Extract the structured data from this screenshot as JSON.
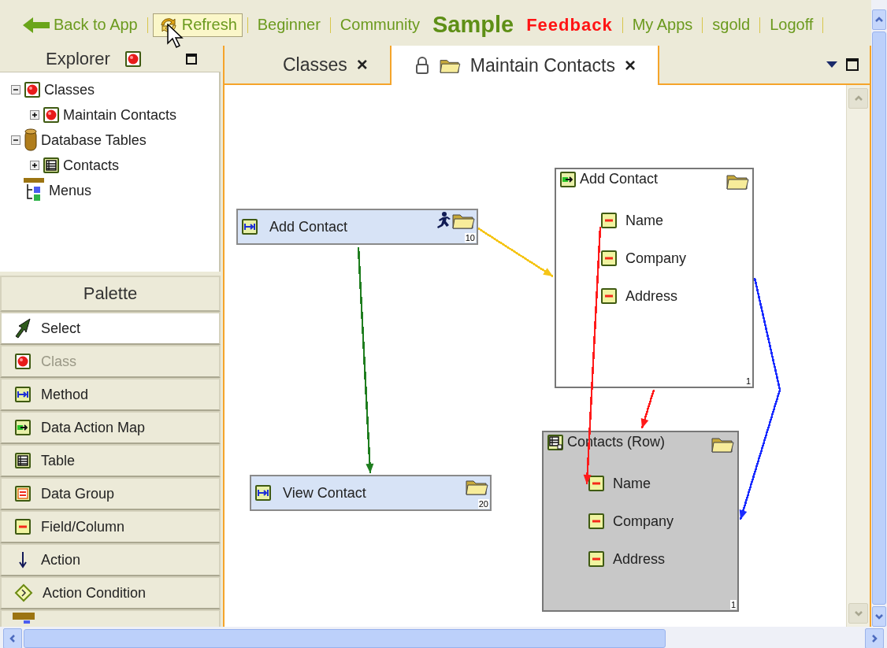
{
  "nav": [
    {
      "label": "Back to App",
      "kind": "back",
      "highlighted": false,
      "divider_after": true
    },
    {
      "label": "Refresh",
      "kind": "refresh",
      "highlighted": true,
      "divider_after": true
    },
    {
      "label": "Beginner",
      "kind": "link",
      "highlighted": false,
      "divider_after": true
    },
    {
      "label": "Community",
      "kind": "link",
      "highlighted": false,
      "divider_after": false
    },
    {
      "label": "Sample",
      "kind": "brand",
      "highlighted": false,
      "divider_after": false
    },
    {
      "label": "Feedback",
      "kind": "feedback",
      "highlighted": false,
      "divider_after": true
    },
    {
      "label": "My Apps",
      "kind": "link",
      "highlighted": false,
      "divider_after": true
    },
    {
      "label": "sgold",
      "kind": "link",
      "highlighted": false,
      "divider_after": true
    },
    {
      "label": "Logoff",
      "kind": "link",
      "highlighted": false,
      "divider_after": true
    }
  ],
  "explorer": {
    "title": "Explorer",
    "tree": [
      {
        "label": "Classes",
        "kind": "class",
        "expanded": true,
        "children": [
          {
            "label": "Maintain Contacts",
            "kind": "class",
            "expanded": false
          }
        ]
      },
      {
        "label": "Database Tables",
        "kind": "database",
        "expanded": true,
        "children": [
          {
            "label": "Contacts",
            "kind": "table",
            "expanded": false
          }
        ]
      },
      {
        "label": "Menus",
        "kind": "menus"
      }
    ]
  },
  "palette": {
    "title": "Palette",
    "items": [
      {
        "label": "Select",
        "kind": "select",
        "selected": true,
        "disabled": false
      },
      {
        "label": "Class",
        "kind": "class",
        "selected": false,
        "disabled": true
      },
      {
        "label": "Method",
        "kind": "method",
        "selected": false,
        "disabled": false
      },
      {
        "label": "Data Action Map",
        "kind": "dam",
        "selected": false,
        "disabled": false
      },
      {
        "label": "Table",
        "kind": "table",
        "selected": false,
        "disabled": false
      },
      {
        "label": "Data Group",
        "kind": "datagroup",
        "selected": false,
        "disabled": false
      },
      {
        "label": "Field/Column",
        "kind": "field",
        "selected": false,
        "disabled": false
      },
      {
        "label": "Action",
        "kind": "action",
        "selected": false,
        "disabled": false
      },
      {
        "label": "Action Condition",
        "kind": "condition",
        "selected": false,
        "disabled": false
      }
    ]
  },
  "tabs": [
    {
      "label": "Classes",
      "close": "×",
      "selected": false,
      "locked": false
    },
    {
      "label": "Maintain Contacts",
      "close": "×",
      "selected": true,
      "locked": true
    }
  ],
  "diagram": {
    "nodes": [
      {
        "kind": "method",
        "title": "Add Contact",
        "order": "10",
        "running": true
      },
      {
        "kind": "method",
        "title": "View Contact",
        "order": "20",
        "running": false
      },
      {
        "kind": "dam",
        "title": "Add Contact",
        "count": "1",
        "fields": [
          "Name",
          "Company",
          "Address"
        ]
      },
      {
        "kind": "table",
        "title": "Contacts (Row)",
        "count": "1",
        "fields": [
          "Name",
          "Company",
          "Address"
        ]
      }
    ],
    "connectors": [
      {
        "color": "#1e7d1e"
      },
      {
        "color": "#f5c518"
      },
      {
        "color": "#ff1a1a"
      },
      {
        "color": "#ff1a1a"
      },
      {
        "color": "#1a2cff"
      }
    ]
  }
}
